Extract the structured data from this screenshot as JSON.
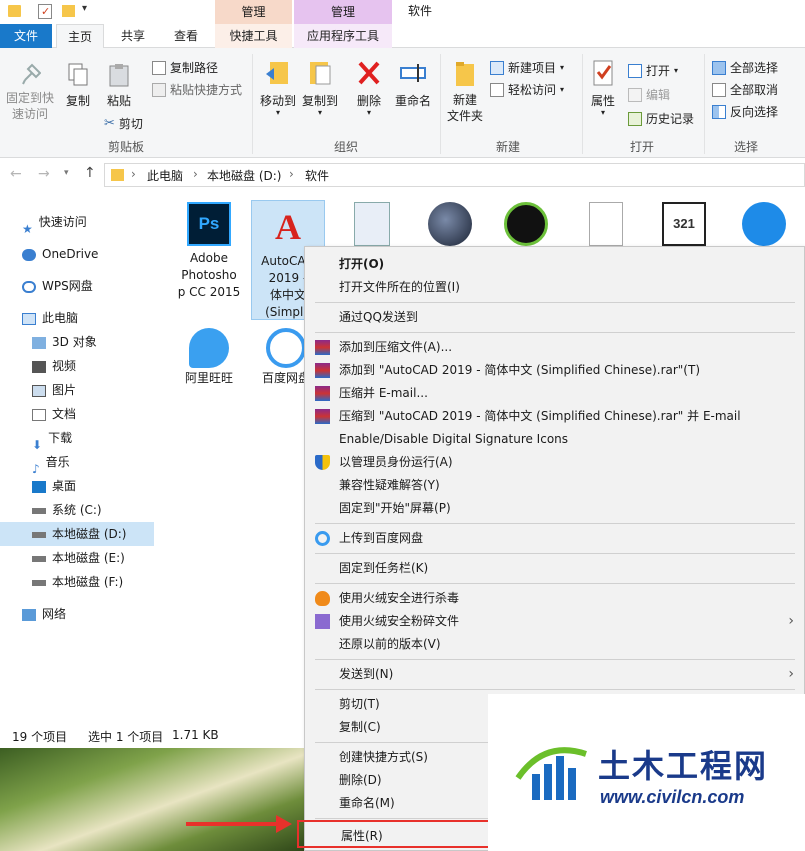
{
  "titlebar": {
    "context_group_1": "管理",
    "context_group_2": "管理",
    "window_title": "软件"
  },
  "ribbon_tabs": [
    "文件",
    "主页",
    "共享",
    "查看",
    "快捷工具",
    "应用程序工具"
  ],
  "ribbon": {
    "clipboard": {
      "pin": "固定到快\n速访问",
      "copy": "复制",
      "paste": "粘贴",
      "copy_path": "复制路径",
      "paste_shortcut": "粘贴快捷方式",
      "cut": "剪切",
      "label": "剪贴板"
    },
    "organize": {
      "move_to": "移动到",
      "copy_to": "复制到",
      "delete": "删除",
      "rename": "重命名",
      "label": "组织"
    },
    "new": {
      "new_folder": "新建\n文件夹",
      "new_item": "新建项目",
      "easy_access": "轻松访问",
      "label": "新建"
    },
    "open": {
      "properties": "属性",
      "open": "打开",
      "edit": "编辑",
      "history": "历史记录",
      "label": "打开"
    },
    "select": {
      "select_all": "全部选择",
      "select_none": "全部取消",
      "invert": "反向选择",
      "label": "选择"
    }
  },
  "address": {
    "crumbs": [
      "此电脑",
      "本地磁盘 (D:)",
      "软件"
    ]
  },
  "nav": {
    "quick_access": "快速访问",
    "onedrive": "OneDrive",
    "wps": "WPS网盘",
    "this_pc": "此电脑",
    "items": [
      "3D 对象",
      "视频",
      "图片",
      "文档",
      "下载",
      "音乐",
      "桌面",
      "系统 (C:)",
      "本地磁盘 (D:)",
      "本地磁盘 (E:)",
      "本地磁盘 (F:)"
    ],
    "network": "网络"
  },
  "files": [
    {
      "name": "Adobe\nPhotosho\np CC 2015"
    },
    {
      "name": "AutoCAD\n2019 -\n体中文\n(Simplif"
    },
    {
      "name": "阿里旺旺"
    },
    {
      "name": "百度网盘"
    }
  ],
  "status": {
    "count": "19 个项目",
    "selected": "选中 1 个项目",
    "size": "1.71 KB"
  },
  "context_menu": {
    "items": [
      {
        "label": "打开(O)",
        "bold": true
      },
      {
        "label": "打开文件所在的位置(I)"
      },
      {
        "label": "通过QQ发送到"
      },
      {
        "label": "添加到压缩文件(A)..."
      },
      {
        "label": "添加到 \"AutoCAD 2019 - 简体中文 (Simplified Chinese).rar\"(T)"
      },
      {
        "label": "压缩并 E-mail..."
      },
      {
        "label": "压缩到 \"AutoCAD 2019 - 简体中文 (Simplified Chinese).rar\" 并 E-mail"
      },
      {
        "label": "Enable/Disable Digital Signature Icons"
      },
      {
        "label": "以管理员身份运行(A)"
      },
      {
        "label": "兼容性疑难解答(Y)"
      },
      {
        "label": "固定到\"开始\"屏幕(P)"
      },
      {
        "label": "上传到百度网盘"
      },
      {
        "label": "固定到任务栏(K)"
      },
      {
        "label": "使用火绒安全进行杀毒"
      },
      {
        "label": "使用火绒安全粉碎文件"
      },
      {
        "label": "还原以前的版本(V)"
      },
      {
        "label": "发送到(N)"
      },
      {
        "label": "剪切(T)"
      },
      {
        "label": "复制(C)"
      },
      {
        "label": "创建快捷方式(S)"
      },
      {
        "label": "删除(D)"
      },
      {
        "label": "重命名(M)"
      },
      {
        "label": "属性(R)"
      }
    ]
  },
  "watermark": {
    "title": "土木工程网",
    "url": "www.civilcn.com"
  },
  "colors": {
    "accent": "#1979ca",
    "ctx_mgmt_1": "#f7d9c9",
    "ctx_mgmt_2": "#e6c3ef",
    "highlight_red": "#e8312b",
    "selected_nav": "#cce4f7"
  }
}
